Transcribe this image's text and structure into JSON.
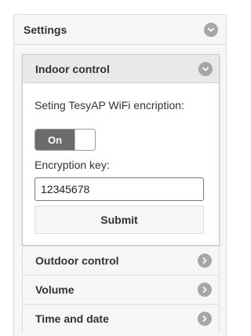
{
  "settings": {
    "title": "Settings",
    "icon": "chevron-down-icon"
  },
  "indoor_control": {
    "title": "Indoor control",
    "icon": "chevron-down-icon",
    "wifi_encryption_label": "Seting TesyAP WiFi encription:",
    "toggle": {
      "state": "On"
    },
    "encryption_key_label": "Encryption key:",
    "encryption_key_value": "12345678",
    "submit_label": "Submit"
  },
  "sections": [
    {
      "label": "Outdoor control",
      "icon": "chevron-right-icon"
    },
    {
      "label": "Volume",
      "icon": "chevron-right-icon"
    },
    {
      "label": "Time and date",
      "icon": "chevron-right-icon"
    }
  ],
  "colors": {
    "icon_circle": "#a6a6a6",
    "toggle_on": "#6b6b6b",
    "header_bg": "#e9e9e9"
  }
}
